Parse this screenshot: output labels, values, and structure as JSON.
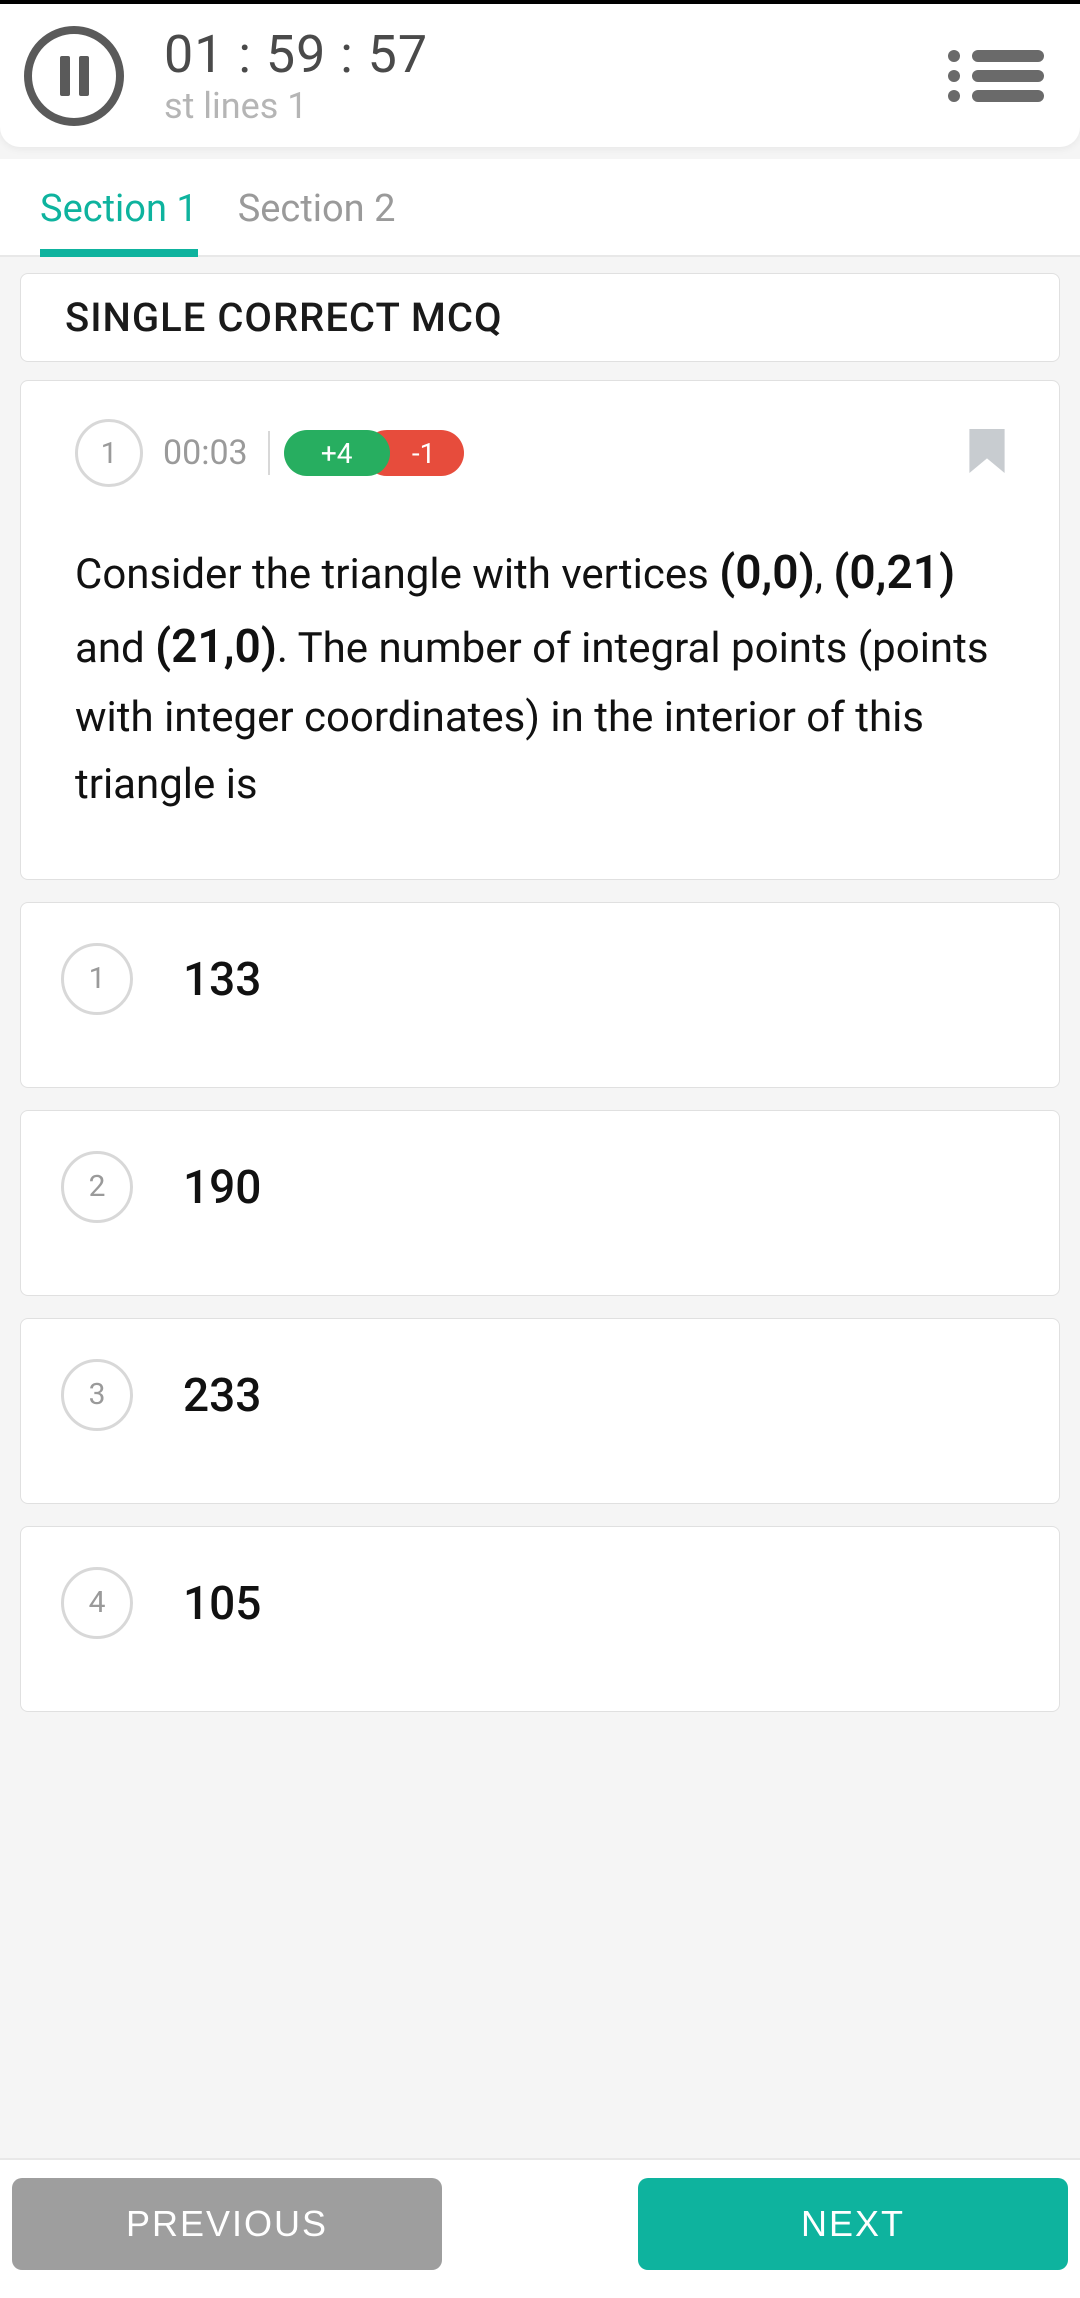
{
  "header": {
    "timer": "01 : 59 : 57",
    "subtitle": "st lines 1"
  },
  "tabs": [
    {
      "label": "Section 1",
      "active": true
    },
    {
      "label": "Section 2",
      "active": false
    }
  ],
  "question_type": "SINGLE CORRECT MCQ",
  "question": {
    "number": "1",
    "time": "00:03",
    "positive_marks": "+4",
    "negative_marks": "-1",
    "text_part1": "Consider the triangle with vertices ",
    "coord1": "(0,0)",
    "sep1": ", ",
    "coord2": "(0,21)",
    "text_part2": " and ",
    "coord3": "(21,0)",
    "text_part3": ". The number of integral points (points with integer coordinates) in the interior of this triangle is"
  },
  "options": [
    {
      "num": "1",
      "text": "133"
    },
    {
      "num": "2",
      "text": "190"
    },
    {
      "num": "3",
      "text": "233"
    },
    {
      "num": "4",
      "text": "105"
    }
  ],
  "footer": {
    "previous": "PREVIOUS",
    "next": "NEXT"
  }
}
